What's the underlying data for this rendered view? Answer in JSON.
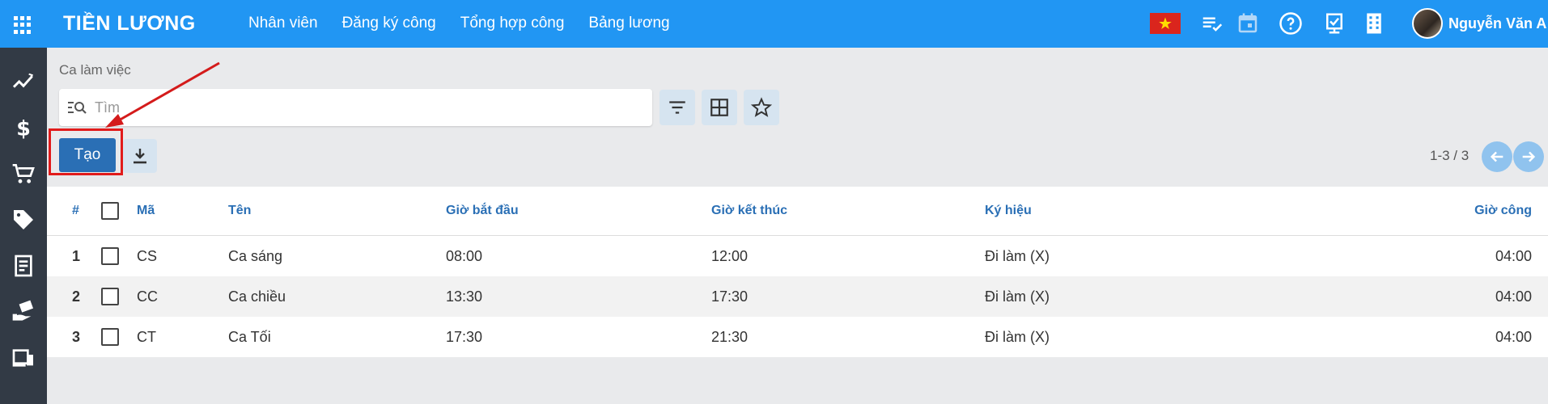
{
  "app": {
    "title": "TIỀN LƯƠNG"
  },
  "nav": [
    "Nhân viên",
    "Đăng ký công",
    "Tổng hợp công",
    "Bảng lương"
  ],
  "user": {
    "name": "Nguyễn Văn A"
  },
  "breadcrumb": "Ca làm việc",
  "search": {
    "placeholder": "Tìm"
  },
  "toolbar": {
    "create_label": "Tạo"
  },
  "pager": {
    "text": "1-3 / 3"
  },
  "table": {
    "headers": {
      "idx": "#",
      "code": "Mã",
      "name": "Tên",
      "start": "Giờ bắt đầu",
      "end": "Giờ kết thúc",
      "symbol": "Ký hiệu",
      "hours": "Giờ công"
    },
    "rows": [
      {
        "idx": "1",
        "code": "CS",
        "name": "Ca sáng",
        "start": "08:00",
        "end": "12:00",
        "symbol": "Đi làm (X)",
        "hours": "04:00"
      },
      {
        "idx": "2",
        "code": "CC",
        "name": "Ca chiều",
        "start": "13:30",
        "end": "17:30",
        "symbol": "Đi làm (X)",
        "hours": "04:00"
      },
      {
        "idx": "3",
        "code": "CT",
        "name": "Ca Tối",
        "start": "17:30",
        "end": "21:30",
        "symbol": "Đi làm (X)",
        "hours": "04:00"
      }
    ]
  },
  "colors": {
    "topbar": "#2196f3",
    "sidebar": "#323a45",
    "primary_button": "#2a6fb5",
    "highlight": "#e11b1b",
    "header_text": "#2a6fb5"
  },
  "icons": {
    "sidebar": [
      "chart-line-icon",
      "dollar-icon",
      "cart-icon",
      "tag-icon",
      "receipt-icon",
      "hand-money-icon",
      "devices-icon"
    ],
    "topbar": [
      "apps-grid-icon",
      "vietnam-flag-icon",
      "checklist-icon",
      "calendar-icon",
      "help-icon",
      "timesheet-icon",
      "building-icon"
    ]
  }
}
